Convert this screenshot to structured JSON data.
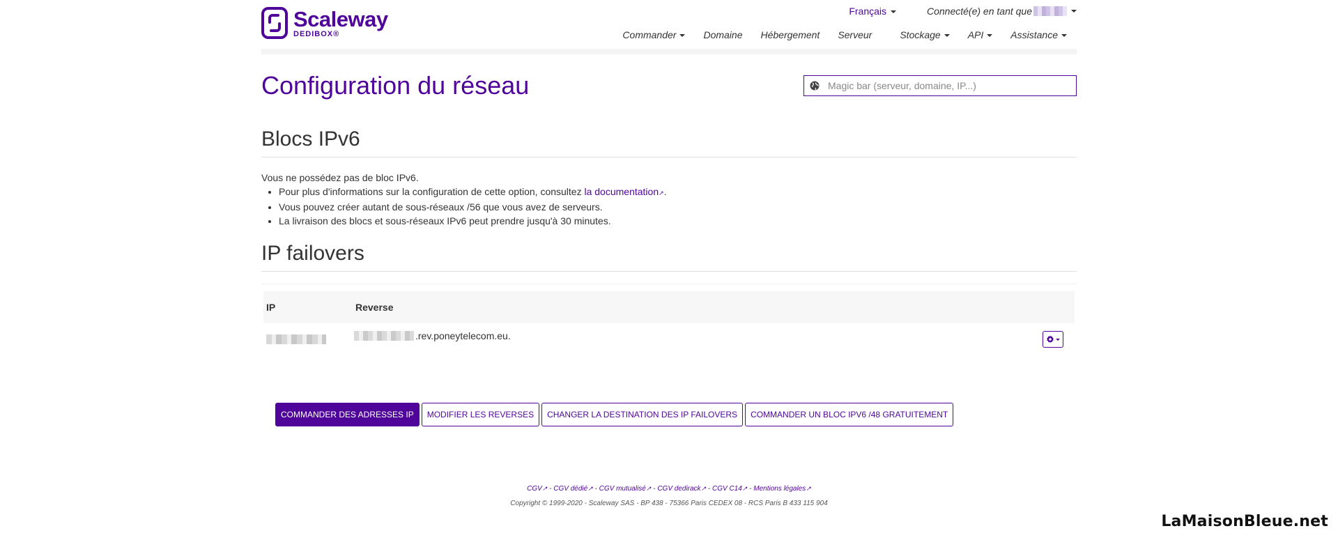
{
  "brand": {
    "name": "Scaleway",
    "product": "DEDIBOX®",
    "color": "#4f0599"
  },
  "topbar": {
    "language": "Français",
    "user_label": "Connecté(e) en tant que"
  },
  "nav": [
    {
      "label": "Commander",
      "dropdown": true
    },
    {
      "label": "Domaine",
      "dropdown": false
    },
    {
      "label": "Hébergement",
      "dropdown": false
    },
    {
      "label": "Serveur",
      "dropdown": false
    },
    {
      "label": "Stockage",
      "dropdown": true
    },
    {
      "label": "API",
      "dropdown": true
    },
    {
      "label": "Assistance",
      "dropdown": true
    }
  ],
  "page": {
    "title": "Configuration du réseau"
  },
  "search": {
    "placeholder": "Magic bar (serveur, domaine, IP...)",
    "icon": "globe-icon"
  },
  "ipv6": {
    "title": "Blocs IPv6",
    "intro": "Vous ne possédez pas de bloc IPv6.",
    "bullet1_prefix": "Pour plus d'informations sur la configuration de cette option, consultez ",
    "bullet1_link": "la documentation",
    "bullet1_suffix": ".",
    "bullet2": "Vous pouvez créer autant de sous-réseaux /56 que vous avez de serveurs.",
    "bullet3": "La livraison des blocs et sous-réseaux IPv6 peut prendre jusqu'à 30 minutes."
  },
  "failovers": {
    "title": "IP failovers",
    "columns": {
      "ip": "IP",
      "reverse": "Reverse"
    },
    "rows": [
      {
        "reverse_suffix": ".rev.poneytelecom.eu."
      }
    ]
  },
  "actions": {
    "order_ips": "COMMANDER DES ADRESSES IP",
    "edit_reverses": "MODIFIER LES REVERSES",
    "change_destination": "CHANGER LA DESTINATION DES IP FAILOVERS",
    "order_ipv6": "COMMANDER UN BLOC IPV6 /48 GRATUITEMENT"
  },
  "footer": {
    "links": [
      "CGV",
      "CGV dédié",
      "CGV mutualisé",
      "CGV dedirack",
      "CGV C14",
      "Mentions légales"
    ],
    "separator": " - ",
    "copyright": "Copyright © 1999-2020 - Scaleway SAS - BP 438 - 75366 Paris CEDEX 08 - RCS Paris B 433 115 904"
  },
  "watermark": "LaMaisonBleue.net"
}
